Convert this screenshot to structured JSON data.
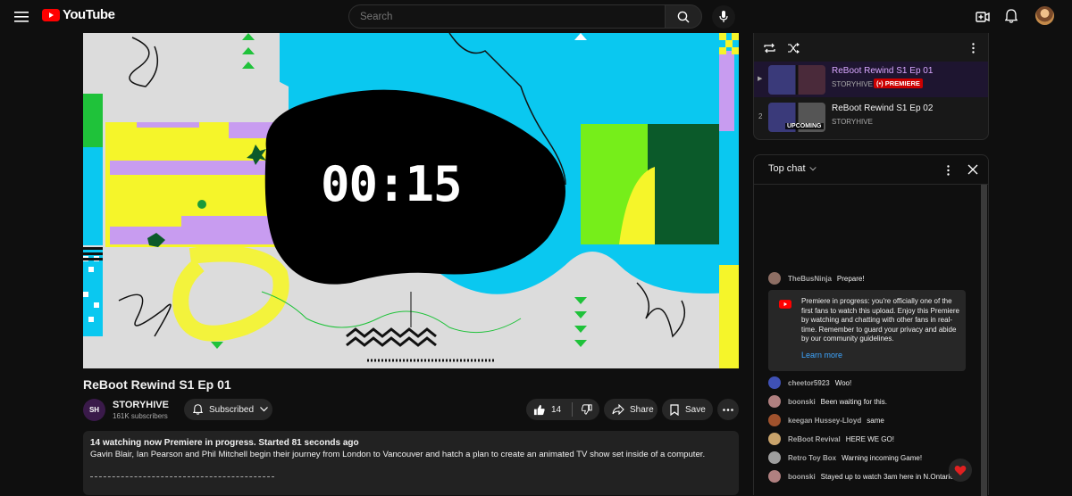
{
  "header": {
    "logo_text": "YouTube",
    "search_placeholder": "Search"
  },
  "video": {
    "countdown": "00:15"
  },
  "watch": {
    "title": "ReBoot Rewind S1 Ep 01",
    "channel_avatar_text": "SH",
    "channel_name": "STORYHIVE",
    "subscribers": "161K subscribers",
    "subscribed_label": "Subscribed",
    "like_count": "14",
    "share_label": "Share",
    "save_label": "Save"
  },
  "description": {
    "stats": "14 watching now  Premiere in progress. Started 81 seconds ago",
    "text": "Gavin Blair, Ian Pearson and Phil Mitchell begin their journey from London to Vancouver and hatch a plan to create an animated TV show set inside of a computer."
  },
  "playlist": {
    "items": [
      {
        "index": "▶",
        "title": "ReBoot Rewind S1 Ep 01",
        "channel": "STORYHIVE",
        "badge": "(•) PREMIERE",
        "active": true
      },
      {
        "index": "2",
        "title": "ReBoot Rewind S1 Ep 02",
        "channel": "STORYHIVE",
        "overlay": "UPCOMING",
        "active": false
      }
    ]
  },
  "chat": {
    "header_label": "Top chat",
    "notice": {
      "text": "Premiere in progress: you're officially one of the first fans to watch this upload. Enjoy this Premiere by watching and chatting with other fans in real-time. Remember to guard your privacy and abide by our community guidelines.",
      "link": "Learn more"
    },
    "messages": [
      {
        "author": "TheBusNinja",
        "text": "Prepare!",
        "color": "#8d6e63"
      },
      {
        "author": "cheetor5923",
        "text": "Woo!",
        "color": "#3f51b5"
      },
      {
        "author": "boonski",
        "text": "Been waiting for this.",
        "color": "#b08080"
      },
      {
        "author": "keegan Hussey-Lloyd",
        "text": "same",
        "color": "#a0522d"
      },
      {
        "author": "ReBoot Revival",
        "text": "HERE WE GO!",
        "color": "#c9a36b"
      },
      {
        "author": "Retro Toy Box",
        "text": "Warning incoming Game!",
        "color": "#9e9e9e"
      },
      {
        "author": "boonski",
        "text": "Stayed up to watch 3am here in N.Ontario",
        "color": "#b08080"
      }
    ]
  }
}
